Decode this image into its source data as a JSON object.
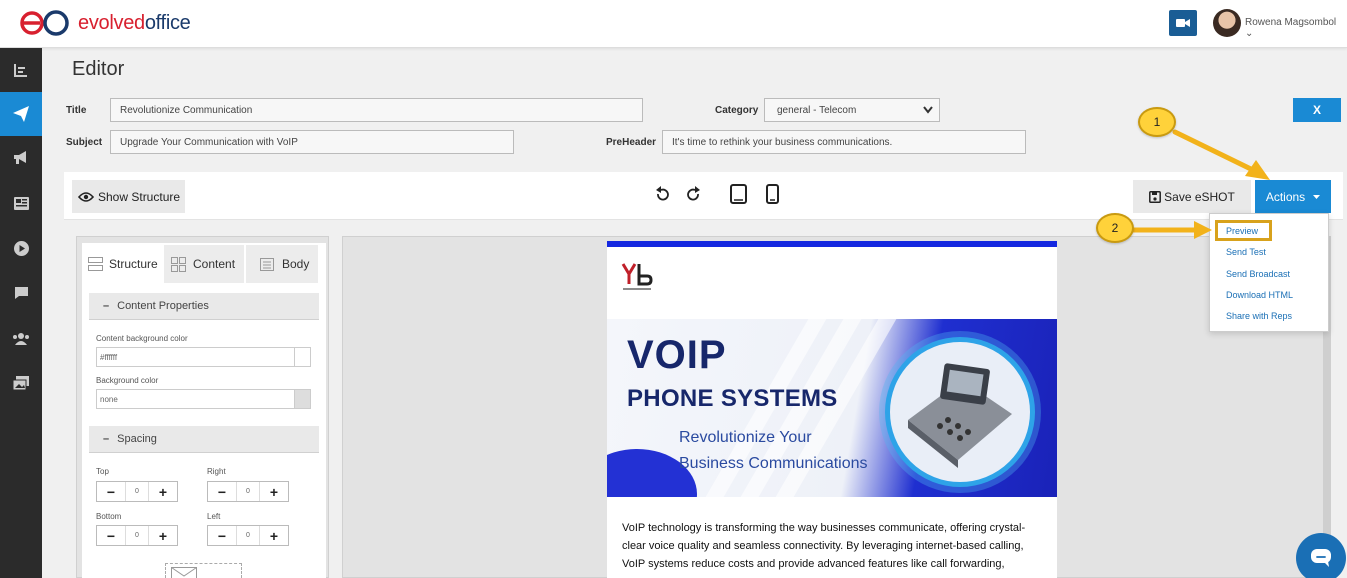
{
  "brand": {
    "name_part1": "evolved",
    "name_part2": "office",
    "red": "#d8202f",
    "navy": "#1a3a6b"
  },
  "user": {
    "name": "Rowena Magsombol"
  },
  "accent": "#1a8ad4",
  "editor": {
    "heading": "Editor",
    "title_label": "Title",
    "title_value": "Revolutionize Communication",
    "subject_label": "Subject",
    "subject_value": "Upgrade Your Communication with VoIP",
    "category_label": "Category",
    "category_value": "general - Telecom",
    "preheader_label": "PreHeader",
    "preheader_value": "It's time to rethink your business communications.",
    "close_label": "X"
  },
  "toolbar": {
    "show_structure": "Show Structure",
    "save": "Save eSHOT",
    "actions": "Actions"
  },
  "actions_menu": [
    "Preview",
    "Send Test",
    "Send Broadcast",
    "Download HTML",
    "Share with Reps"
  ],
  "panel": {
    "tabs": [
      "Structure",
      "Content",
      "Body"
    ],
    "content_properties": "Content Properties",
    "content_bg_label": "Content background color",
    "content_bg_value": "#ffffff",
    "bg_label": "Background color",
    "bg_value": "none",
    "spacing": "Spacing",
    "top_label": "Top",
    "right_label": "Right",
    "bottom_label": "Bottom",
    "left_label": "Left",
    "top_value": "0",
    "right_value": "0",
    "bottom_value": "0",
    "left_value": "0"
  },
  "email": {
    "banner_title": "VOIP",
    "banner_subtitle": "PHONE SYSTEMS",
    "banner_line1": "Revolutionize Your",
    "banner_line2": "Business Communications",
    "body_line1": "VoIP technology is transforming the way businesses communicate, offering crystal-",
    "body_line2": "clear voice quality and seamless connectivity. By leveraging internet-based calling,",
    "body_line3": "VoIP systems reduce costs and provide advanced features like call forwarding,"
  },
  "callouts": {
    "one": "1",
    "two": "2"
  }
}
